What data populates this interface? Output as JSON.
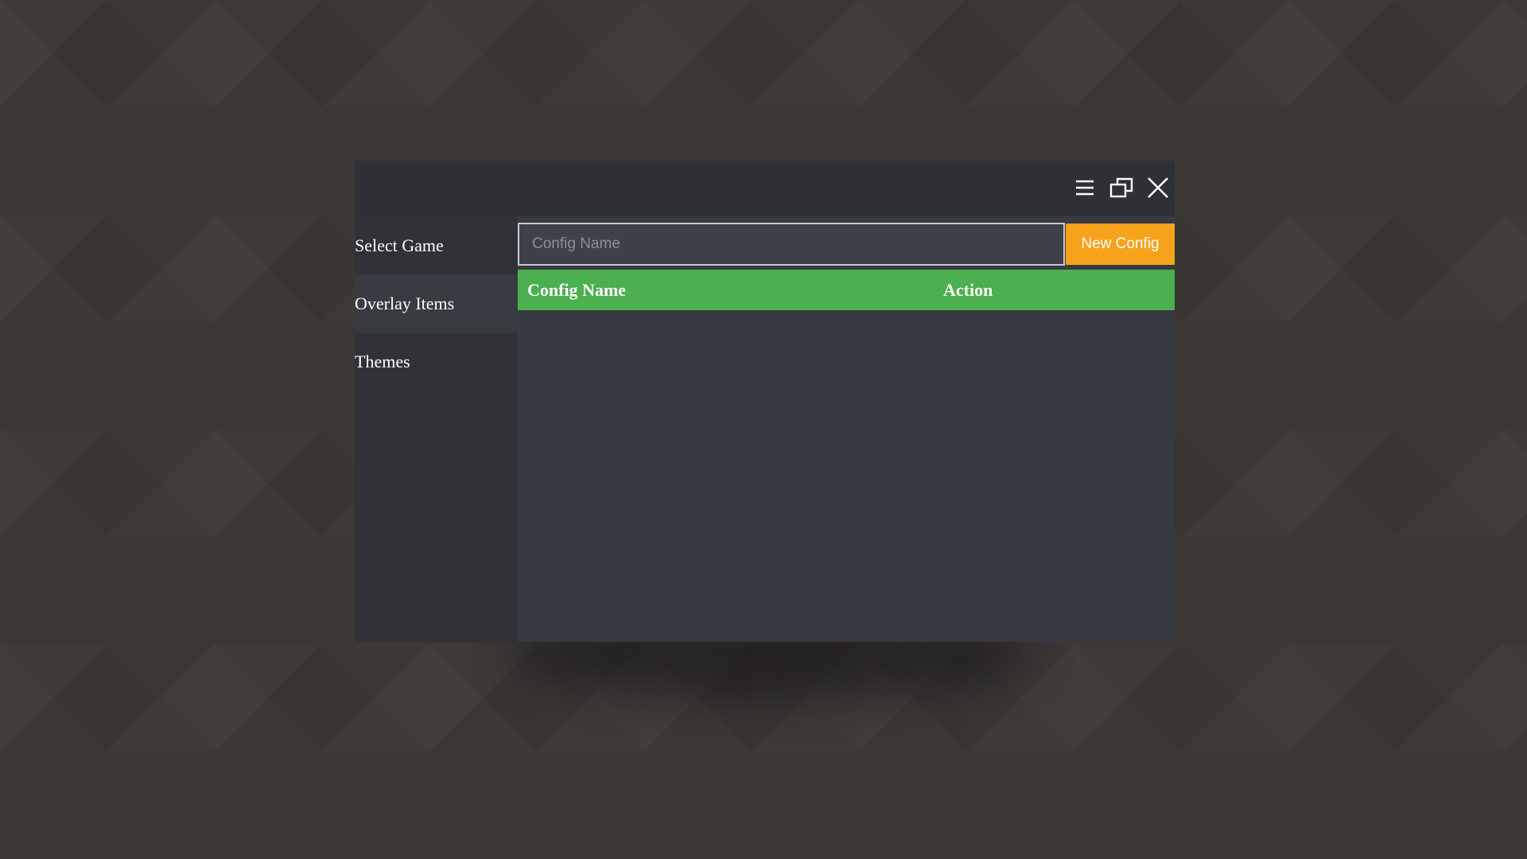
{
  "window": {
    "controls": [
      {
        "icon": "menu-icon"
      },
      {
        "icon": "restore-icon"
      },
      {
        "icon": "close-icon"
      }
    ]
  },
  "sidebar": {
    "items": [
      {
        "label": "Select Game",
        "active": false
      },
      {
        "label": "Overlay Items",
        "active": true
      },
      {
        "label": "Themes",
        "active": false
      }
    ]
  },
  "config": {
    "input_placeholder": "Config Name",
    "input_value": "",
    "new_button_label": "New Config"
  },
  "table": {
    "headers": [
      "Config Name",
      "Action"
    ],
    "rows": []
  },
  "colors": {
    "accent_orange": "#f7a21b",
    "header_green": "#4caf50",
    "sidebar_bg": "#313237",
    "content_bg": "#373a43"
  }
}
